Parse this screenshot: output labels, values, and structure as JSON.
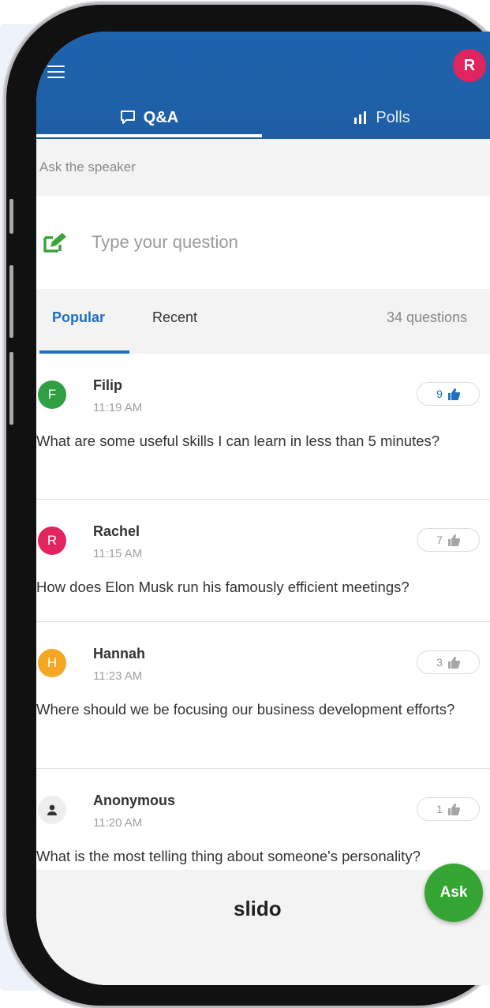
{
  "header": {
    "avatar_initial": "R",
    "tabs": [
      {
        "label": "Q&A",
        "icon": "chat-bubble-icon"
      },
      {
        "label": "Polls",
        "icon": "bar-chart-icon"
      }
    ]
  },
  "ask": {
    "label": "Ask the speaker",
    "placeholder": "Type your question"
  },
  "filter": {
    "popular": "Popular",
    "recent": "Recent",
    "count": "34 questions"
  },
  "questions": [
    {
      "initial": "F",
      "name": "Filip",
      "time": "11:19 AM",
      "likes": "9",
      "text": "What are some useful skills I can learn in less than 5 minutes?",
      "color": "#2ea043"
    },
    {
      "initial": "R",
      "name": "Rachel",
      "time": "11:15 AM",
      "likes": "7",
      "text": "How does Elon Musk run his famously efficient meetings?",
      "color": "#e0245e"
    },
    {
      "initial": "H",
      "name": "Hannah",
      "time": "11:23 AM",
      "likes": "3",
      "text": "Where should we be focusing our business development efforts?",
      "color": "#f5a623"
    },
    {
      "initial": "",
      "name": "Anonymous",
      "time": "11:20 AM",
      "likes": "1",
      "text": "What is the most telling thing about someone's personality?",
      "color": "#eeeeee"
    }
  ],
  "footer": {
    "brand": "slido",
    "ask_button": "Ask"
  },
  "colors": {
    "header": "#1e63ad",
    "accent": "#1e6fbf",
    "ask_button": "#35a534"
  }
}
